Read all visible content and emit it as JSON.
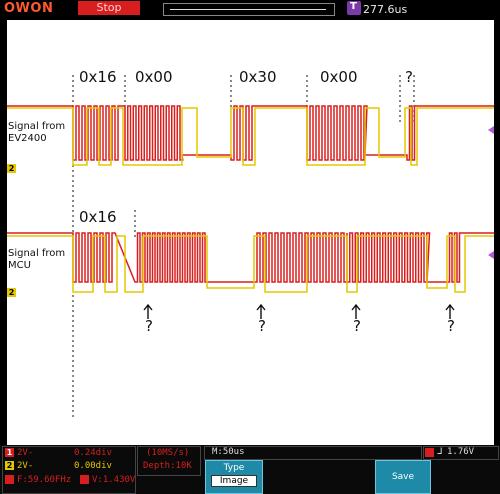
{
  "topbar": {
    "logo": "OWON",
    "run_state": "Stop",
    "trigger_tag": "T",
    "h_position": "277.6us"
  },
  "annotations": {
    "top_bytes": [
      "0x16",
      "0x00",
      "0x30",
      "0x00",
      "?"
    ],
    "bottom_bytes": [
      "0x16"
    ],
    "question": "?",
    "sig_top_line1": "Signal from",
    "sig_top_line2": "EV2400",
    "sig_bottom_line1": "Signal from",
    "sig_bottom_line2": "MCU"
  },
  "channels": {
    "ch1_tag": "1",
    "ch2_tag": "2",
    "ch1_color": "#d81e1e",
    "ch2_color": "#e5c800"
  },
  "panel": {
    "ch1_volts": "2V-",
    "ch1_offset": "0.24div",
    "ch2_volts": "2V-",
    "ch2_offset": "0.00div",
    "freq": "F:59.60FHz",
    "trig_val": "V:1.430V",
    "sample_rate": "(10MS/s)",
    "depth": "Depth:10K",
    "timebase": "M:50us",
    "trig_level": "1.76V",
    "type_label": "Type",
    "image_label": "Image",
    "save_label": "Save"
  }
}
